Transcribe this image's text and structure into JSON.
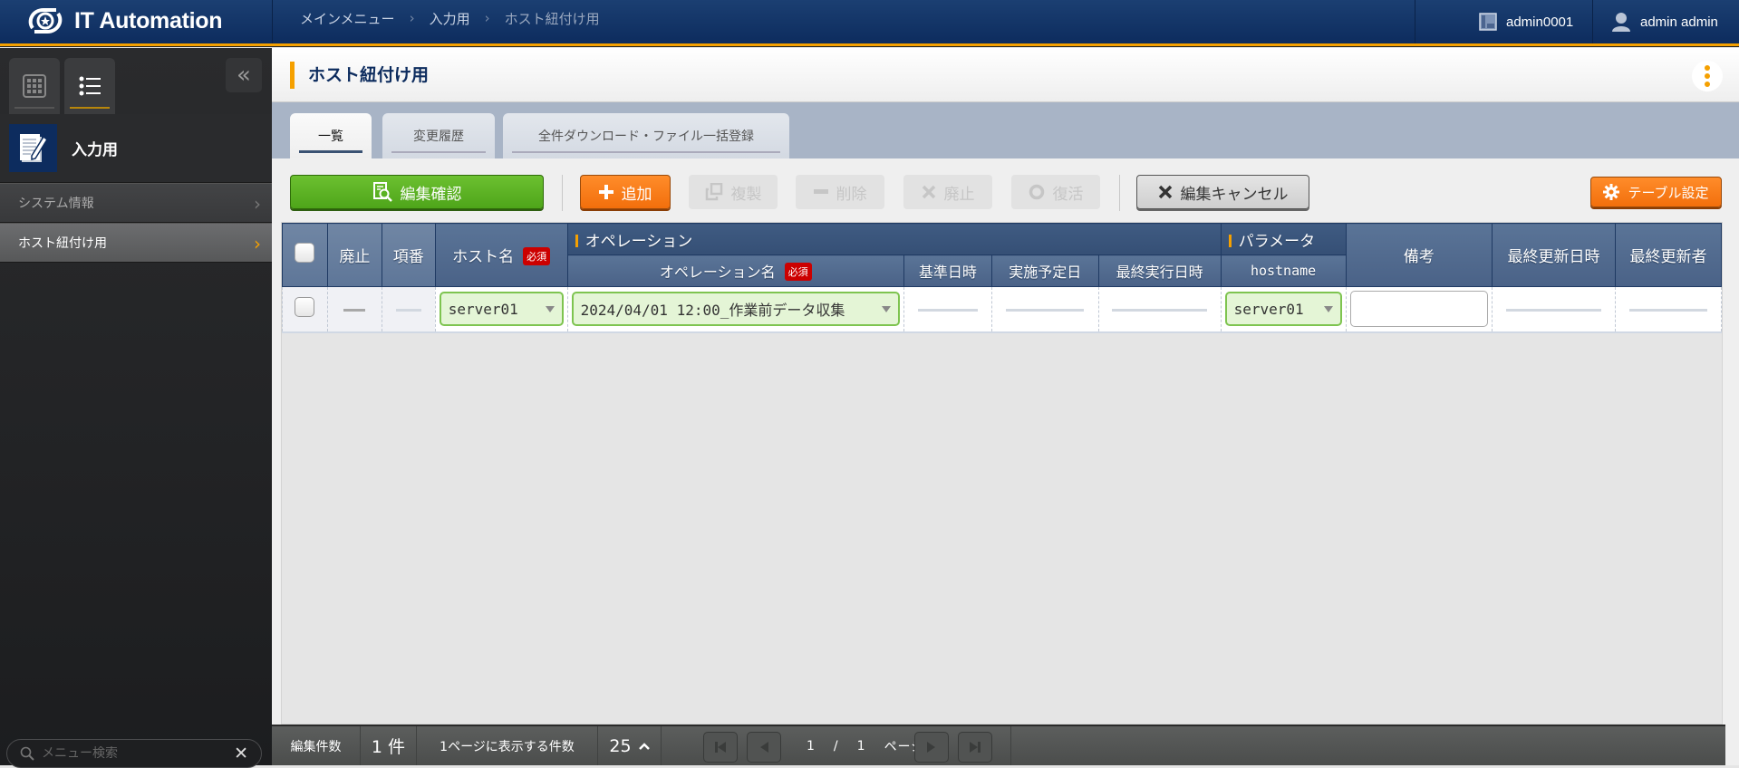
{
  "header": {
    "app_title": "IT Automation",
    "breadcrumb": [
      "メインメニュー",
      "入力用",
      "ホスト紐付け用"
    ],
    "workspace": "admin0001",
    "user": "admin admin"
  },
  "sidebar": {
    "tabs": [
      {
        "icon": "grid-icon"
      },
      {
        "icon": "list-icon"
      }
    ],
    "group_label": "入力用",
    "items": [
      {
        "label": "システム情報",
        "active": false
      },
      {
        "label": "ホスト紐付け用",
        "active": true
      }
    ],
    "search_placeholder": "メニュー検索"
  },
  "page": {
    "title": "ホスト紐付け用",
    "tabs": [
      {
        "label": "一覧",
        "active": true
      },
      {
        "label": "変更履歴",
        "active": false
      },
      {
        "label": "全件ダウンロード・ファイル一括登録",
        "active": false
      }
    ]
  },
  "toolbar": {
    "confirm": "編集確認",
    "add": "追加",
    "duplicate": "複製",
    "delete": "削除",
    "discard": "廃止",
    "restore": "復活",
    "cancel": "編集キャンセル",
    "table_settings": "テーブル設定"
  },
  "table": {
    "headers": {
      "discard": "廃止",
      "item_no": "項番",
      "host_name": "ホスト名",
      "operation_group": "オペレーション",
      "operation_name": "オペレーション名",
      "base_datetime": "基準日時",
      "scheduled_date": "実施予定日",
      "last_exec": "最終実行日時",
      "parameter_group": "パラメータ",
      "hostname": "hostname",
      "remarks": "備考",
      "last_updated": "最終更新日時",
      "last_updated_by": "最終更新者"
    },
    "required_badge": "必須",
    "rows": [
      {
        "host_name": "server01",
        "operation_name": "2024/04/01 12:00_作業前データ収集",
        "hostname": "server01",
        "remarks": ""
      }
    ]
  },
  "footer": {
    "edit_count_label": "編集件数",
    "edit_count": "1 件",
    "per_page_label": "1ページに表示する件数",
    "per_page": "25",
    "page_current": "1",
    "page_sep": "/",
    "page_total": "1",
    "page_unit": "ページ"
  }
}
